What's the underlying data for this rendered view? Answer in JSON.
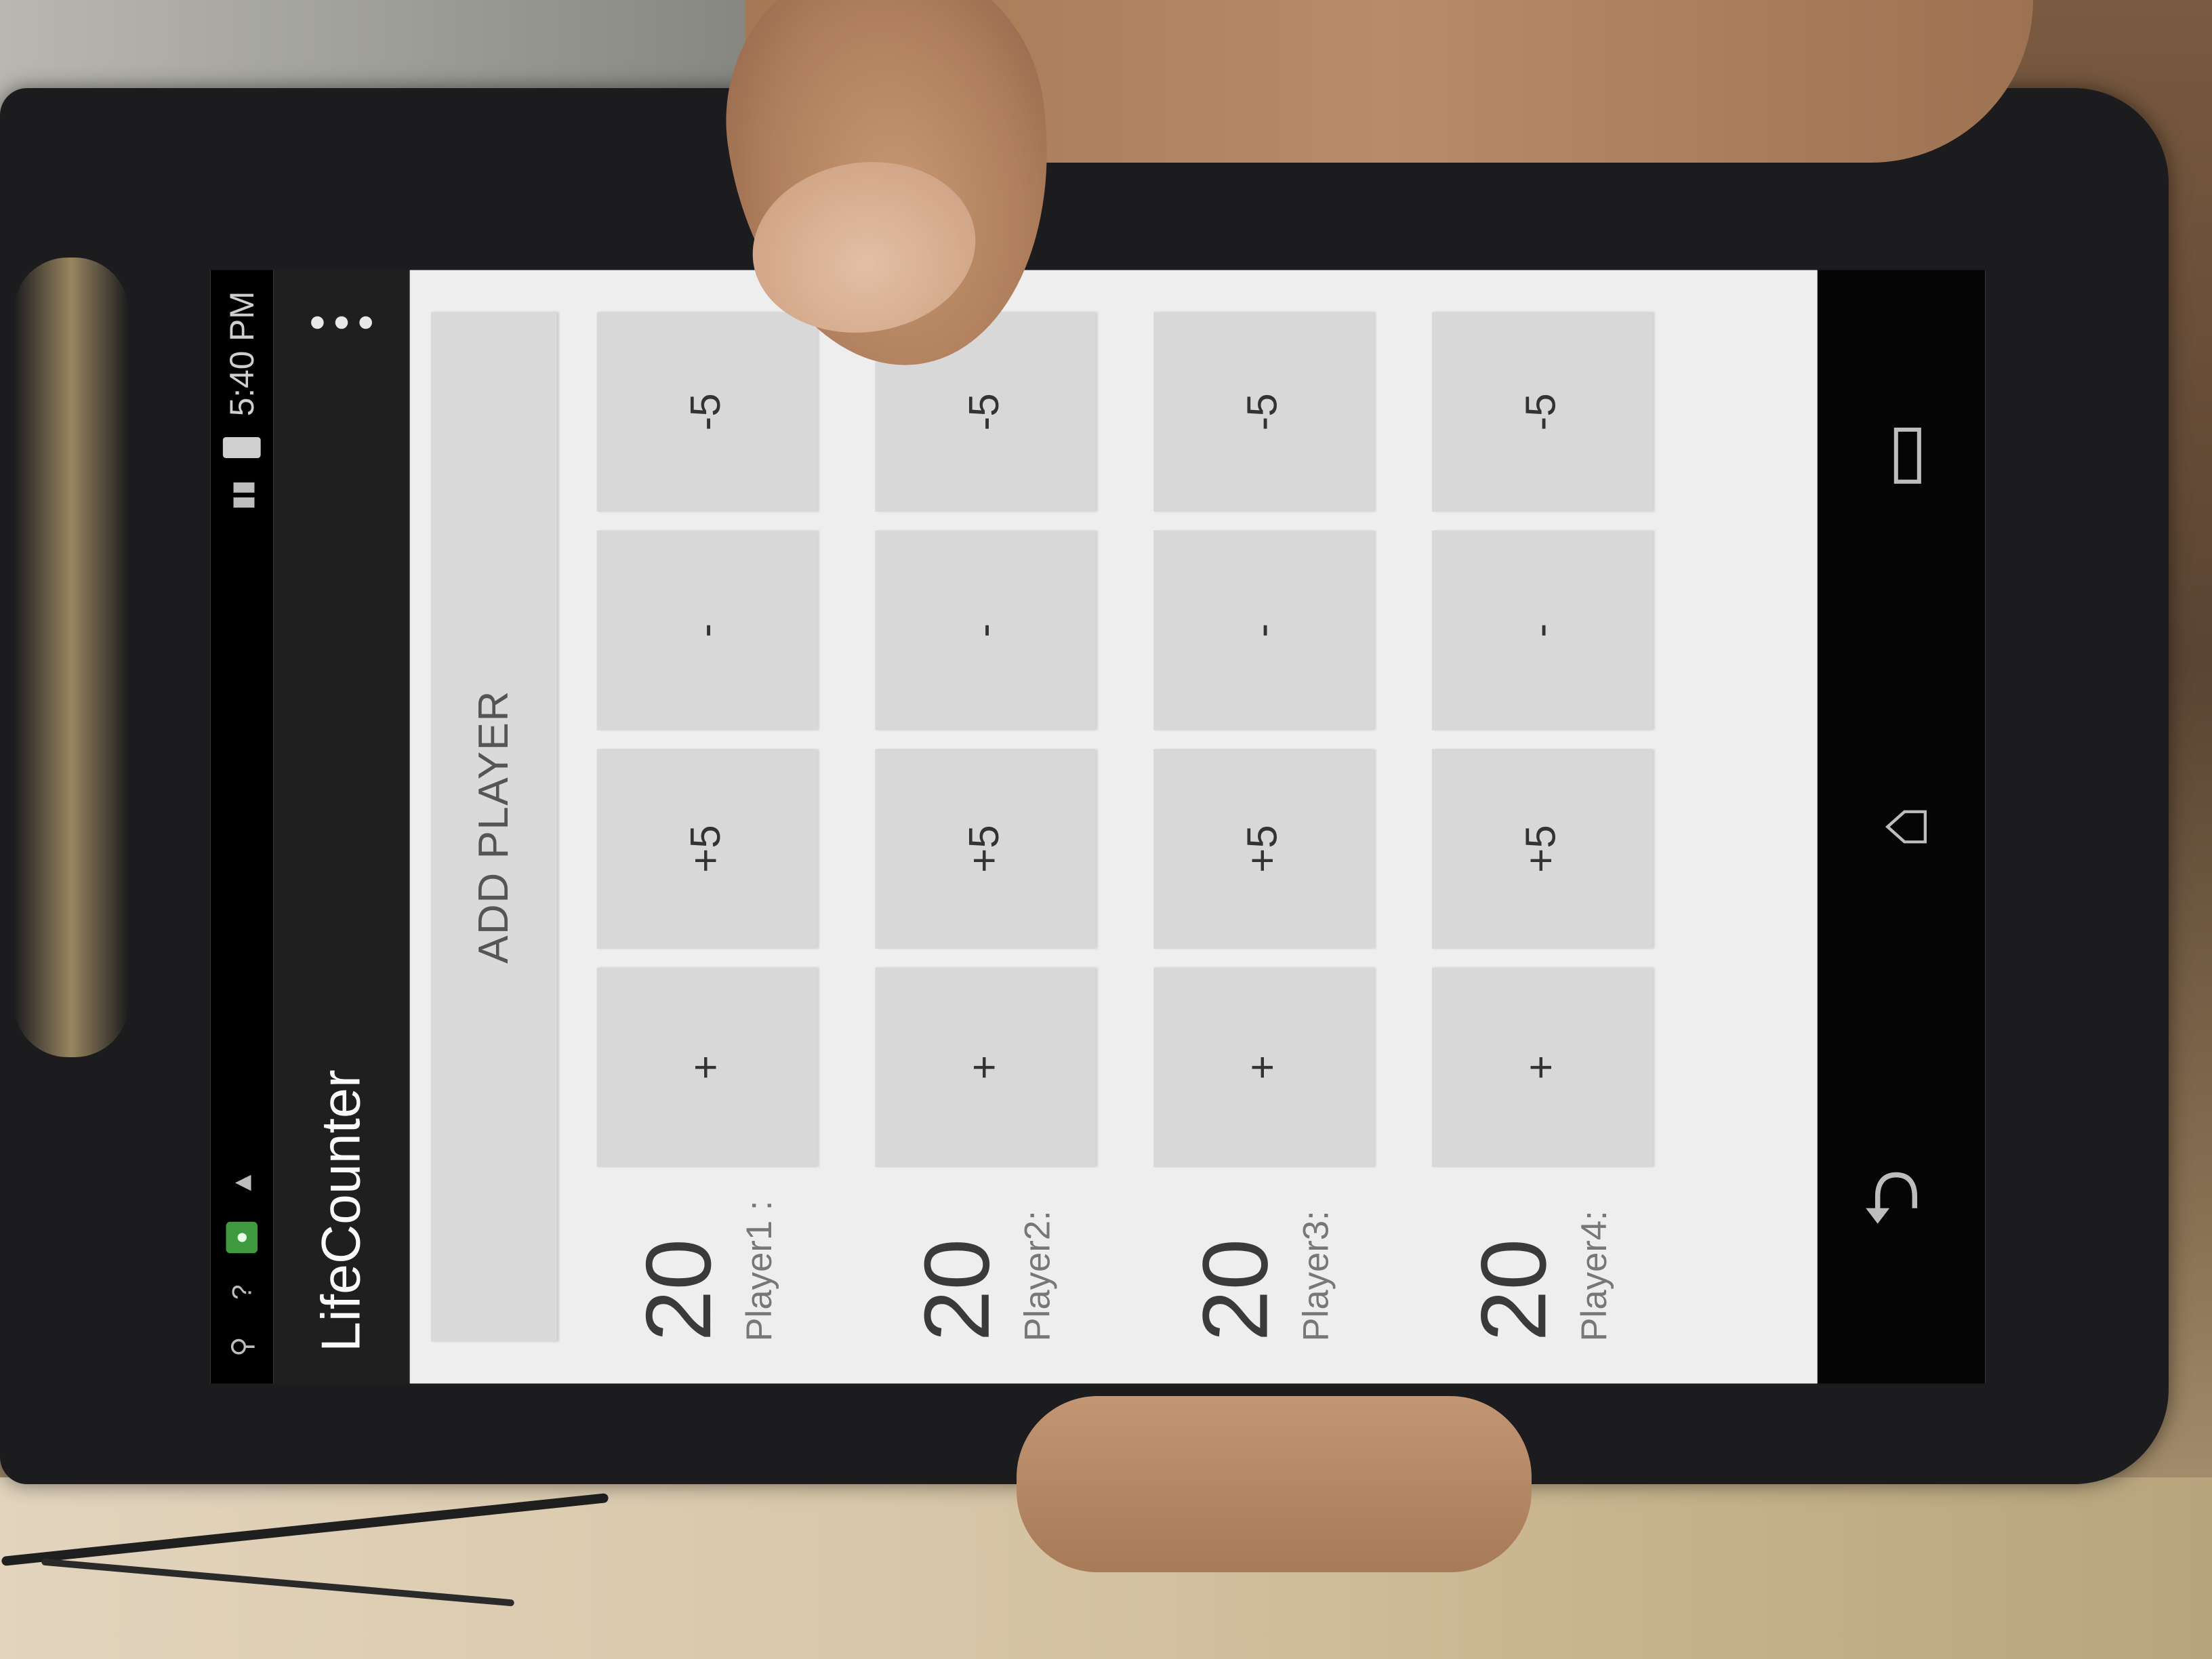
{
  "status_bar": {
    "time": "5:40 PM",
    "icons": [
      "usb-icon",
      "unknown-notification-icon",
      "green-app-icon",
      "warning-icon",
      "signal-icon",
      "battery-icon"
    ]
  },
  "action_bar": {
    "title": "LifeCounter",
    "menu_icon": "overflow-menu-icon"
  },
  "add_player": {
    "label": "ADD PLAYER"
  },
  "players": [
    {
      "life": "20",
      "name": "Player1 :",
      "plus": "+",
      "plus5": "+5",
      "minus": "-",
      "minus5": "-5"
    },
    {
      "life": "20",
      "name": "Player2:",
      "plus": "+",
      "plus5": "+5",
      "minus": "-",
      "minus5": "-5"
    },
    {
      "life": "20",
      "name": "Player3:",
      "plus": "+",
      "plus5": "+5",
      "minus": "-",
      "minus5": "-5"
    },
    {
      "life": "20",
      "name": "Player4:",
      "plus": "+",
      "plus5": "+5",
      "minus": "-",
      "minus5": "-5"
    }
  ],
  "nav": {
    "back": "⮌",
    "home": "⌂",
    "recents": "▭"
  },
  "colors": {
    "screen_bg": "#eeeeee",
    "button_bg": "#d8d8d8",
    "action_bar_bg": "#1f1f1f",
    "phone_body": "#1c1c1e"
  }
}
